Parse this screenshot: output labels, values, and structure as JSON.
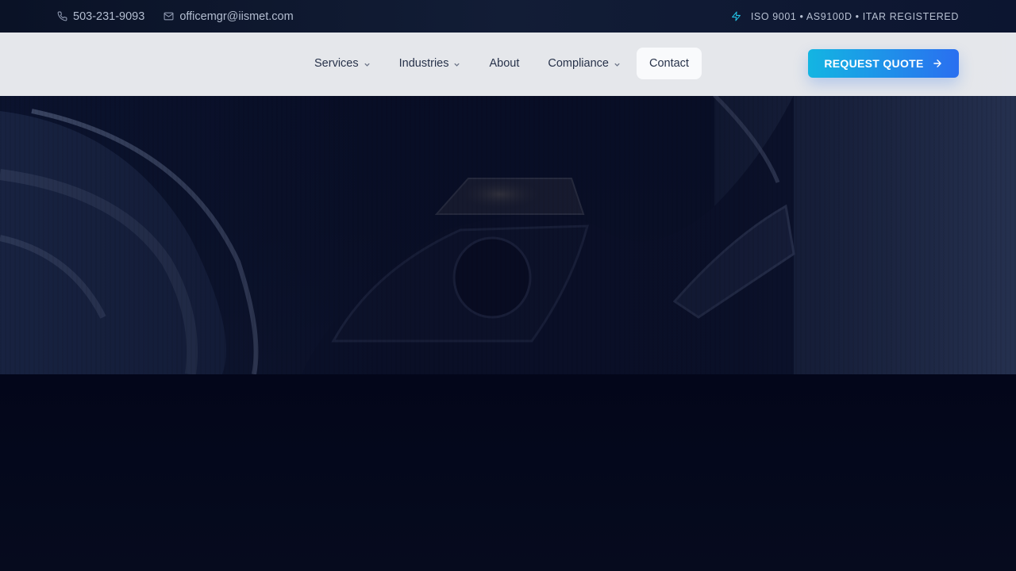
{
  "topbar": {
    "phone": "503-231-9093",
    "email": "officemgr@iismet.com",
    "certifications": "ISO 9001 • AS9100D • ITAR REGISTERED",
    "icons": {
      "phone": "phone-icon",
      "email": "mail-icon",
      "certifications": "lightning-icon"
    }
  },
  "nav": {
    "items": [
      {
        "label": "Services",
        "has_dropdown": true
      },
      {
        "label": "Industries",
        "has_dropdown": true
      },
      {
        "label": "About",
        "has_dropdown": false
      },
      {
        "label": "Compliance",
        "has_dropdown": true
      },
      {
        "label": "Contact",
        "has_dropdown": false,
        "active": true
      }
    ]
  },
  "cta": {
    "label": "REQUEST QUOTE",
    "icon": "arrow-right-icon"
  },
  "colors": {
    "topbar_bg": "#0f1830",
    "header_bg": "#eef0f4",
    "nav_text": "#27324a",
    "cta_start": "#13b5e2",
    "cta_end": "#2a6ff0",
    "page_bg": "#050a1c",
    "accent": "#22c3e6"
  }
}
